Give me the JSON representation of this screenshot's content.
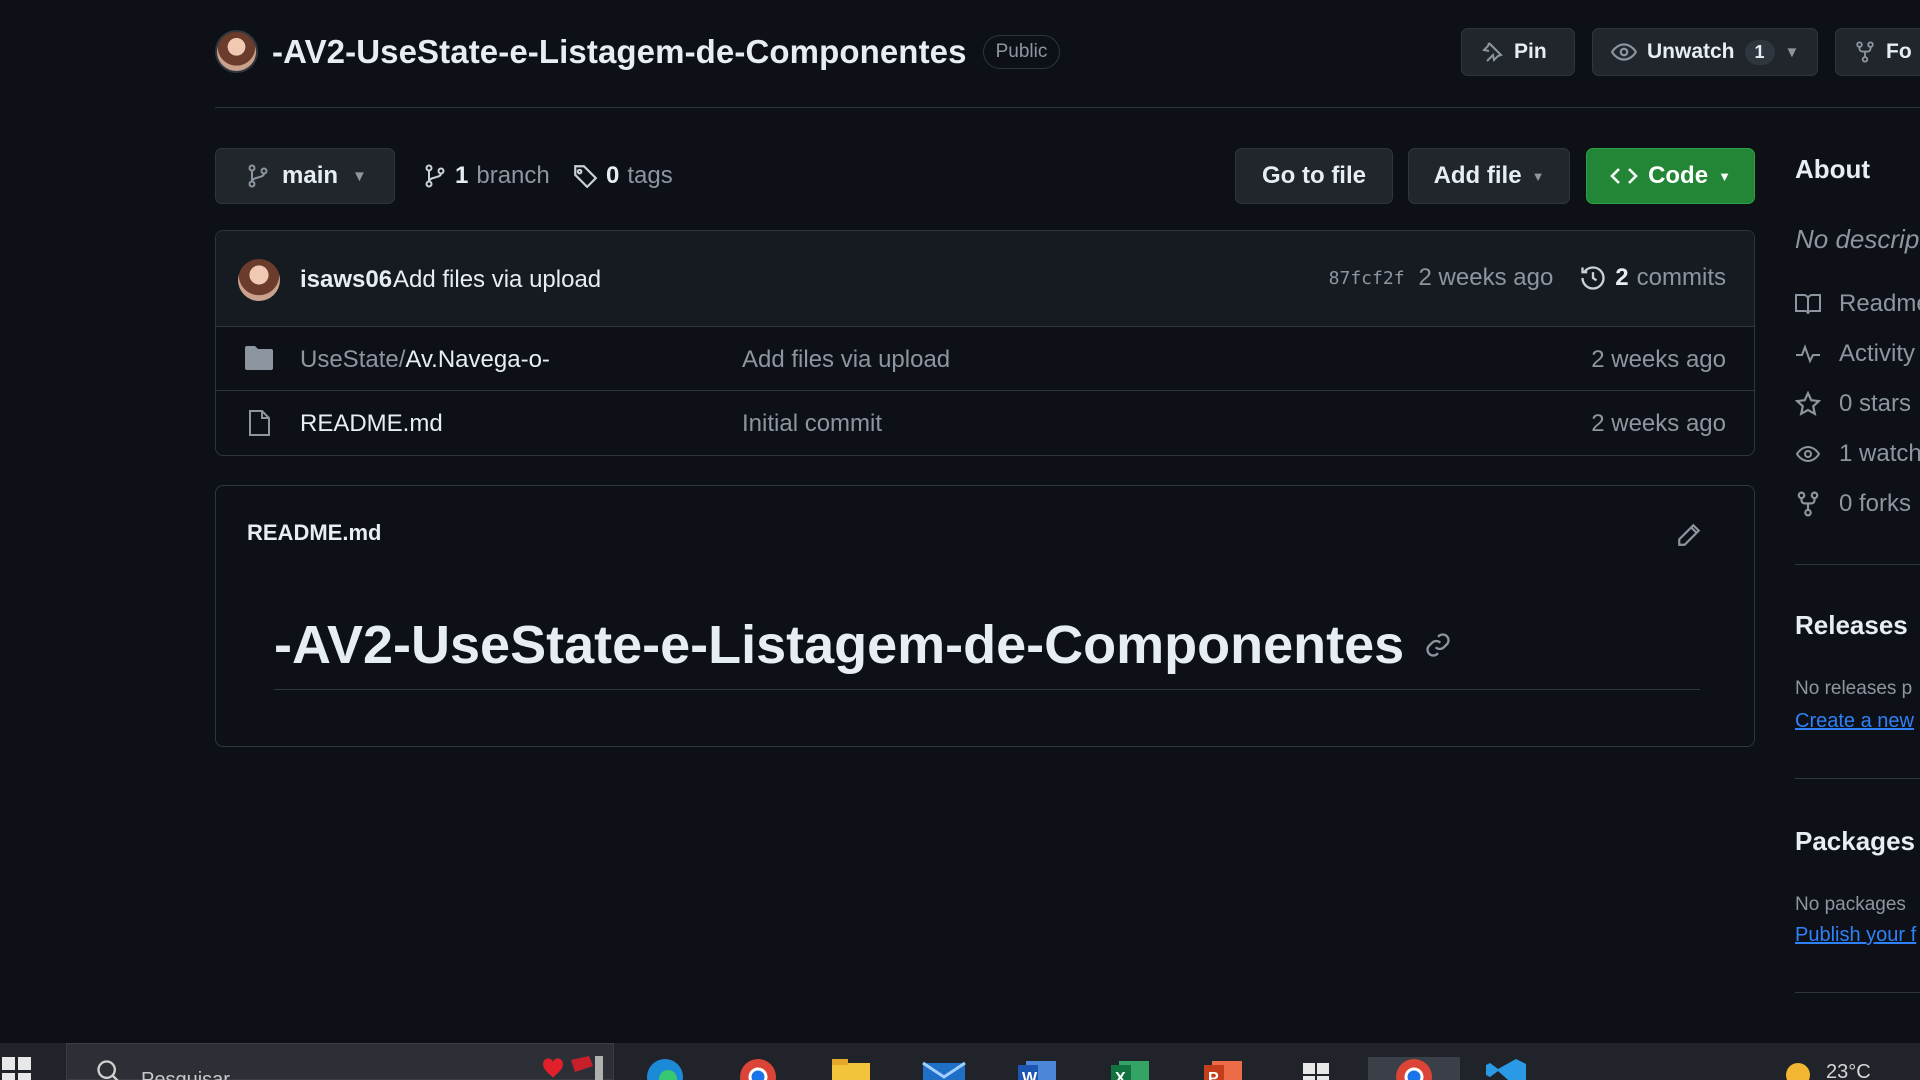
{
  "repo": {
    "name": "-AV2-UseState-e-Listagem-de-Componentes",
    "visibility": "Public",
    "actions": {
      "pin_label": "Pin",
      "unwatch_label": "Unwatch",
      "watch_count": "1",
      "fork_label": "Fo"
    }
  },
  "toolbar": {
    "branch": "main",
    "branch_count": "1",
    "branch_word": "branch",
    "tag_count": "0",
    "tag_word": "tags",
    "go_to_file": "Go to file",
    "add_file": "Add file",
    "code": "Code"
  },
  "latest_commit": {
    "author": "isaws06",
    "message": "Add files via upload",
    "sha": "87fcf2f",
    "time": "2 weeks ago",
    "commit_count": "2",
    "commit_word": "commits"
  },
  "files": [
    {
      "type": "folder",
      "name_prefix": "UseState/",
      "name": "Av.Navega-o-",
      "commit": "Add files via upload",
      "time": "2 weeks ago"
    },
    {
      "type": "file",
      "name_prefix": "",
      "name": "README.md",
      "commit": "Initial commit",
      "time": "2 weeks ago"
    }
  ],
  "readme": {
    "label": "README.md",
    "heading": "-AV2-UseState-e-Listagem-de-Componentes"
  },
  "sidebar": {
    "about_title": "About",
    "about_desc": "No descrip",
    "items": [
      {
        "icon": "book-icon",
        "label": "Readme"
      },
      {
        "icon": "pulse-icon",
        "label": "Activity"
      },
      {
        "icon": "star-icon",
        "label": "0 stars"
      },
      {
        "icon": "eye-icon",
        "label": "1 watch"
      },
      {
        "icon": "fork-icon",
        "label": "0 forks"
      }
    ],
    "releases_title": "Releases",
    "releases_desc": "No releases p",
    "releases_link": "Create a new",
    "packages_title": "Packages",
    "packages_desc": "No packages",
    "packages_link": "Publish your f"
  },
  "taskbar": {
    "search_placeholder": "Pesquisar",
    "weather": "23°C"
  },
  "colors": {
    "background": "#0d1117",
    "border": "#30363d",
    "button_bg": "#21262d",
    "code_green": "#238636",
    "muted_text": "#8d96a0",
    "link_blue": "#2f81f7"
  }
}
